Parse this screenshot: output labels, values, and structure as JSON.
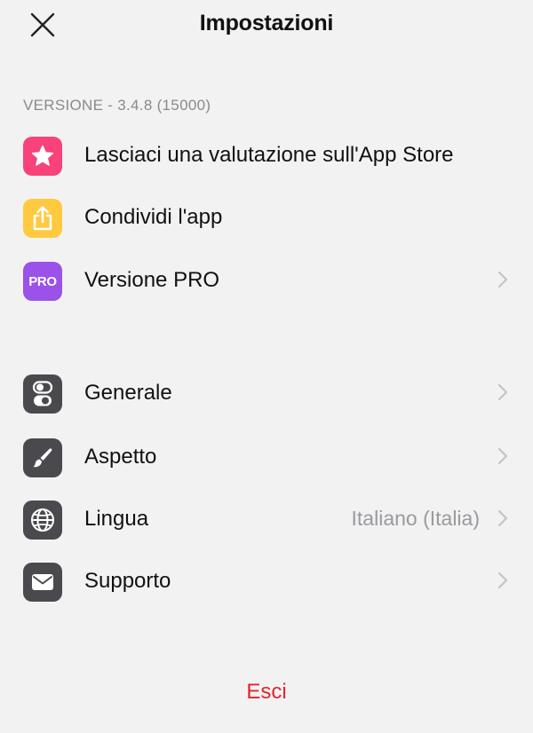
{
  "header": {
    "title": "Impostazioni"
  },
  "version_label": "VERSIONE - 3.4.8 (15000)",
  "section1": {
    "items": [
      {
        "label": "Lasciaci una valutazione sull'App Store",
        "icon": "star-icon",
        "icon_color": "#f7437a"
      },
      {
        "label": "Condividi l'app",
        "icon": "share-icon",
        "icon_color": "#ffc940"
      },
      {
        "label": "Versione PRO",
        "icon": "pro-icon",
        "icon_text": "PRO",
        "icon_color": "#9a52e8"
      }
    ]
  },
  "section2": {
    "items": [
      {
        "label": "Generale",
        "icon": "toggle-icon",
        "icon_color": "#4a4a4e"
      },
      {
        "label": "Aspetto",
        "icon": "brush-icon",
        "icon_color": "#4a4a4e"
      },
      {
        "label": "Lingua",
        "value": "Italiano (Italia)",
        "icon": "globe-icon",
        "icon_color": "#4a4a4e"
      },
      {
        "label": "Supporto",
        "icon": "mail-icon",
        "icon_color": "#4a4a4e"
      }
    ]
  },
  "exit_label": "Esci",
  "colors": {
    "background": "#f2f2f3",
    "destructive": "#e0262a",
    "secondary_text": "#8a8a8e"
  }
}
